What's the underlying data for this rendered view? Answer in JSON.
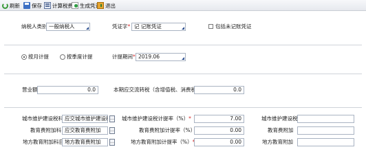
{
  "toolbar": {
    "refresh": "刷新",
    "save": "保存",
    "calc": "计算税费",
    "generate": "生成凭证",
    "exit": "退出"
  },
  "taxpayer": {
    "label": "纳税人类别",
    "value": "一般纳税人"
  },
  "voucher": {
    "label": "凭证字",
    "value": "记 记账凭证"
  },
  "include_unposted": {
    "label": "包括未记账凭证",
    "checked": false
  },
  "period_mode": {
    "monthly": "按月计提",
    "quarterly": "按季度计提",
    "selected": "monthly"
  },
  "accrual_period": {
    "label": "计提期间",
    "value": "2019.06"
  },
  "revenue": {
    "label": "营业额",
    "value": "0.0"
  },
  "vat_turnover": {
    "label": "本期应交流转税（含增值税、消费税）",
    "value": "0.0"
  },
  "rows": [
    {
      "subject_label": "城市维护建设税科目",
      "subject_value": "应交城市维护建设税",
      "rate_label": "城市维护建设税计提率（%）",
      "rate_value": "7.00",
      "amount_label": "城市维护建设税",
      "amount_value": ""
    },
    {
      "subject_label": "教育费附加科目",
      "subject_value": "应交教育费附加",
      "rate_label": "教育费附加计提率（%）",
      "rate_value": "0.00",
      "amount_label": "教育费附加",
      "amount_value": ""
    },
    {
      "subject_label": "地方教育附加科目",
      "subject_value": "地方教育费附加",
      "rate_label": "地方教育附加计提率（%）",
      "rate_value": "0.00",
      "amount_label": "地方教育附加",
      "amount_value": ""
    }
  ],
  "colors": {
    "required": "#d42a2a",
    "field_border": "#a9b3c2",
    "toolbar_bg": "#e6e9ee"
  }
}
